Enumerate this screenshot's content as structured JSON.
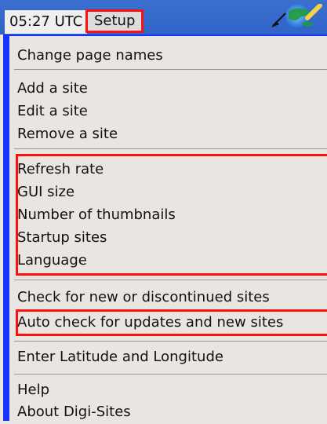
{
  "topbar": {
    "time": "05:27 UTC",
    "setup": "Setup"
  },
  "menu": {
    "items": [
      "Change page names",
      "Add a site",
      "Edit a site",
      "Remove a site",
      "Refresh rate",
      "GUI size",
      "Number of thumbnails",
      "Startup sites",
      "Language",
      "Check for new or discontinued sites",
      "Auto check for updates and new sites",
      "Enter Latitude and Longitude",
      "Help",
      "About Digi-Sites"
    ]
  },
  "colors": {
    "titlebar": "#2f64c6",
    "highlight_red": "#ff1010",
    "menu_border_blue": "#1533ff"
  },
  "icons": [
    "globe-icon",
    "submenu-arrow-icon"
  ]
}
